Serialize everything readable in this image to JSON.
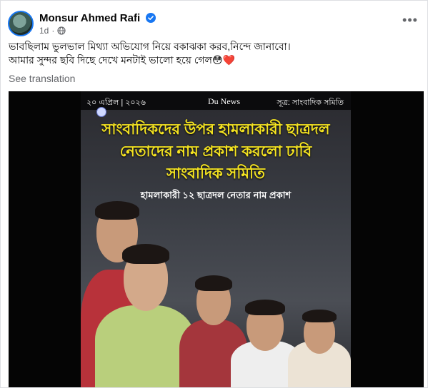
{
  "post": {
    "author": "Monsur Ahmed Rafi",
    "time": "1d",
    "privacy_icon": "globe-icon",
    "more_icon": "more-options-icon",
    "text_line1": "ভাবছিলাম ভুলভাল মিথ্যা অভিযোগ নিয়ে বকাঝকা করব,নিন্দে জানাবো।",
    "text_line2": "আমার সুন্দর ছবি দিছে দেখে মনটাই ভালো হয়ে গেল😳❤️",
    "see_translation": "See translation"
  },
  "poster": {
    "date": "২০ এপ্রিল | ২০২৬",
    "outlet": "Du News",
    "source": "সূত্র: সাংবাদিক সমিতি",
    "headline_line1": "সাংবাদিকদের উপর হামলাকারী ছাত্রদল",
    "headline_line2": "নেতাদের নাম প্রকাশ করলো ঢাবি",
    "headline_line3": "সাংবাদিক সমিতি",
    "subheadline": "হামলাকারী ১২ ছাত্রদল নেতার নাম প্রকাশ"
  },
  "colors": {
    "brand_blue": "#1877f2",
    "headline_yellow": "#f6e521",
    "muted_gray": "#65676b"
  }
}
